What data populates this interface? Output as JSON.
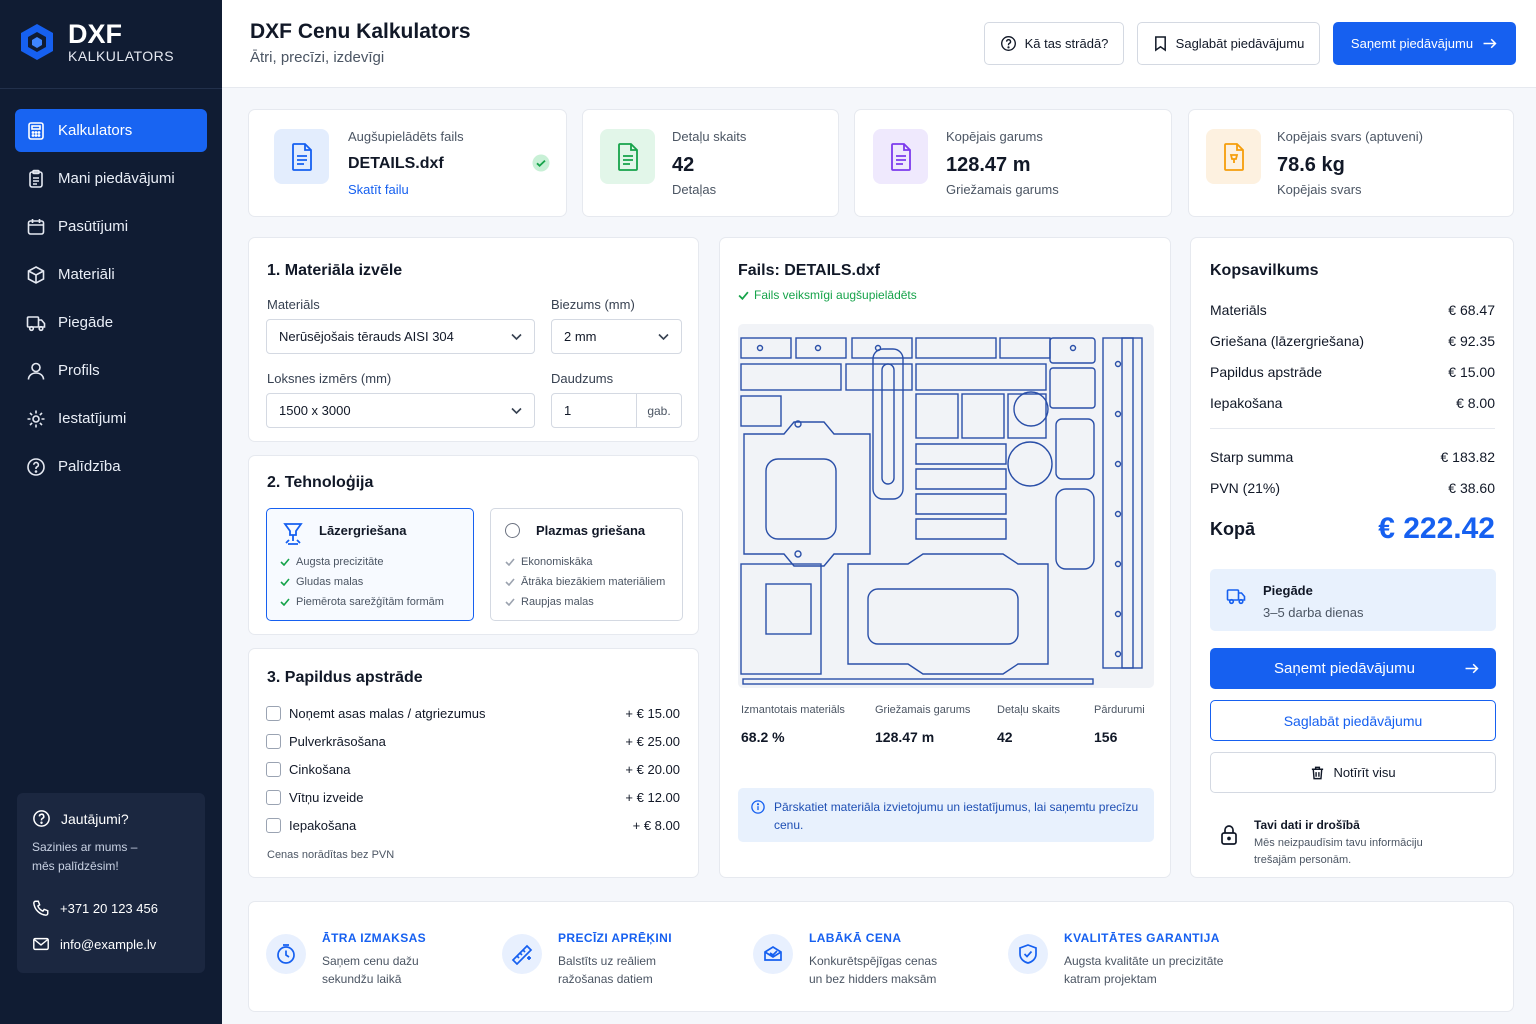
{
  "brand": {
    "name": "DXF",
    "tagline": "KALKULATORS"
  },
  "nav": [
    {
      "label": "Kalkulators",
      "icon": "calculator-icon",
      "active": true
    },
    {
      "label": "Mani piedāvājumi",
      "icon": "clipboard-icon"
    },
    {
      "label": "Pasūtījumi",
      "icon": "calendar-icon"
    },
    {
      "label": "Materiāli",
      "icon": "cube-icon"
    },
    {
      "label": "Piegāde",
      "icon": "truck-icon"
    },
    {
      "label": "Profils",
      "icon": "user-icon"
    },
    {
      "label": "Iestatījumi",
      "icon": "gear-icon"
    },
    {
      "label": "Palīdzība",
      "icon": "question-icon"
    }
  ],
  "help": {
    "title": "Jautājumi?",
    "text": "Sazinies ar mums – mēs palīdzēsim!",
    "phone": "+371 20 123 456",
    "email": "info@example.lv"
  },
  "header": {
    "title": "DXF Cenu Kalkulators",
    "subtitle": "Ātri, precīzi, izdevīgi",
    "how_label": "Kā tas strādā?",
    "save_label": "Saglabāt piedāvājumu",
    "get_label": "Saņemt piedāvājumu"
  },
  "stats": {
    "file": {
      "label": "Augšupielādēts fails",
      "value": "DETAILS.dxf",
      "link": "Skatīt failu"
    },
    "parts": {
      "label": "Detaļu skaits",
      "value": "42",
      "sub": "Detaļas"
    },
    "length": {
      "label": "Kopējais garums",
      "value": "128.47 m",
      "sub": "Griežamais garums"
    },
    "weight": {
      "label": "Kopējais svars (aptuveni)",
      "value": "78.6 kg",
      "sub": "Kopējais svars"
    }
  },
  "material": {
    "title": "1.  Materiāla izvēle",
    "material_label": "Materiāls",
    "material_value": "Nerūsējošais tērauds AISI 304",
    "thickness_label": "Biezums (mm)",
    "thickness_value": "2 mm",
    "sheet_label": "Loksnes izmērs (mm)",
    "sheet_value": "1500 x 3000",
    "qty_label": "Daudzums",
    "qty_value": "1",
    "qty_unit": "gab."
  },
  "technology": {
    "title": "2.  Tehnoloģija",
    "laser": {
      "name": "Lāzergriešana",
      "features": [
        "Augsta precizitāte",
        "Gludas malas",
        "Piemērota sarežģītām formām"
      ],
      "selected": true
    },
    "plasma": {
      "name": "Plazmas griešana",
      "features": [
        "Ekonomiskāka",
        "Ātrāka biezākiem materiāliem",
        "Raupjas malas"
      ],
      "selected": false
    }
  },
  "extras": {
    "title": "3.  Papildus apstrāde",
    "items": [
      {
        "label": "Noņemt asas malas / atgriezumus",
        "price": "+ € 15.00"
      },
      {
        "label": "Pulverkrāsošana",
        "price": "+ € 25.00"
      },
      {
        "label": "Cinkošana",
        "price": "+ € 20.00"
      },
      {
        "label": "Vītņu izveide",
        "price": "+ € 12.00"
      },
      {
        "label": "Iepakošana",
        "price": "+ € 8.00"
      }
    ],
    "note": "Cenas norādītas bez PVN"
  },
  "preview": {
    "title": "Fails: DETAILS.dxf",
    "status": "Fails veiksmīgi augšupielādēts",
    "metrics": [
      {
        "label": "Izmantotais materiāls",
        "value": "68.2 %"
      },
      {
        "label": "Griežamais garums",
        "value": "128.47 m"
      },
      {
        "label": "Detaļu skaits",
        "value": "42"
      },
      {
        "label": "Pārdurumi",
        "value": "156"
      }
    ],
    "info": "Pārskatiet materiāla izvietojumu un iestatījumus, lai saņemtu precīzu cenu."
  },
  "summary": {
    "title": "Kopsavilkums",
    "rows": [
      {
        "label": "Materiāls",
        "value": "€ 68.47"
      },
      {
        "label": "Griešana (lāzergriešana)",
        "value": "€ 92.35"
      },
      {
        "label": "Papildus apstrāde",
        "value": "€ 15.00"
      },
      {
        "label": "Iepakošana",
        "value": "€ 8.00"
      }
    ],
    "subtotal_label": "Starp summa",
    "subtotal_value": "€ 183.82",
    "vat_label": "PVN (21%)",
    "vat_value": "€ 38.60",
    "total_label": "Kopā",
    "total_value": "€ 222.42",
    "delivery_title": "Piegāde",
    "delivery_text": "3–5 darba dienas",
    "get_label": "Saņemt piedāvājumu",
    "save_label": "Saglabāt piedāvājumu",
    "clear_label": "Notīrīt visu",
    "secure_title": "Tavi dati ir drošībā",
    "secure_text": "Mēs neizpaudīsim tavu informāciju trešajām personām."
  },
  "features": [
    {
      "title": "ĀTRA IZMAKSAS",
      "text": "Saņem cenu dažu sekundžu laikā",
      "icon": "clock-icon"
    },
    {
      "title": "PRECĪZI APRĒĶINI",
      "text": "Balstīts uz reāliem ražošanas datiem",
      "icon": "ruler-icon"
    },
    {
      "title": "LABĀKĀ CENA",
      "text": "Konkurētspējīgas cenas un bez hidders maksām",
      "icon": "tag-icon"
    },
    {
      "title": "KVALITĀTES GARANTIJA",
      "text": "Augsta kvalitāte un precizitāte katram projektam",
      "icon": "shield-icon"
    }
  ],
  "colors": {
    "accent": "#1660f0",
    "sidebar": "#101c33",
    "success": "#16a34a"
  }
}
